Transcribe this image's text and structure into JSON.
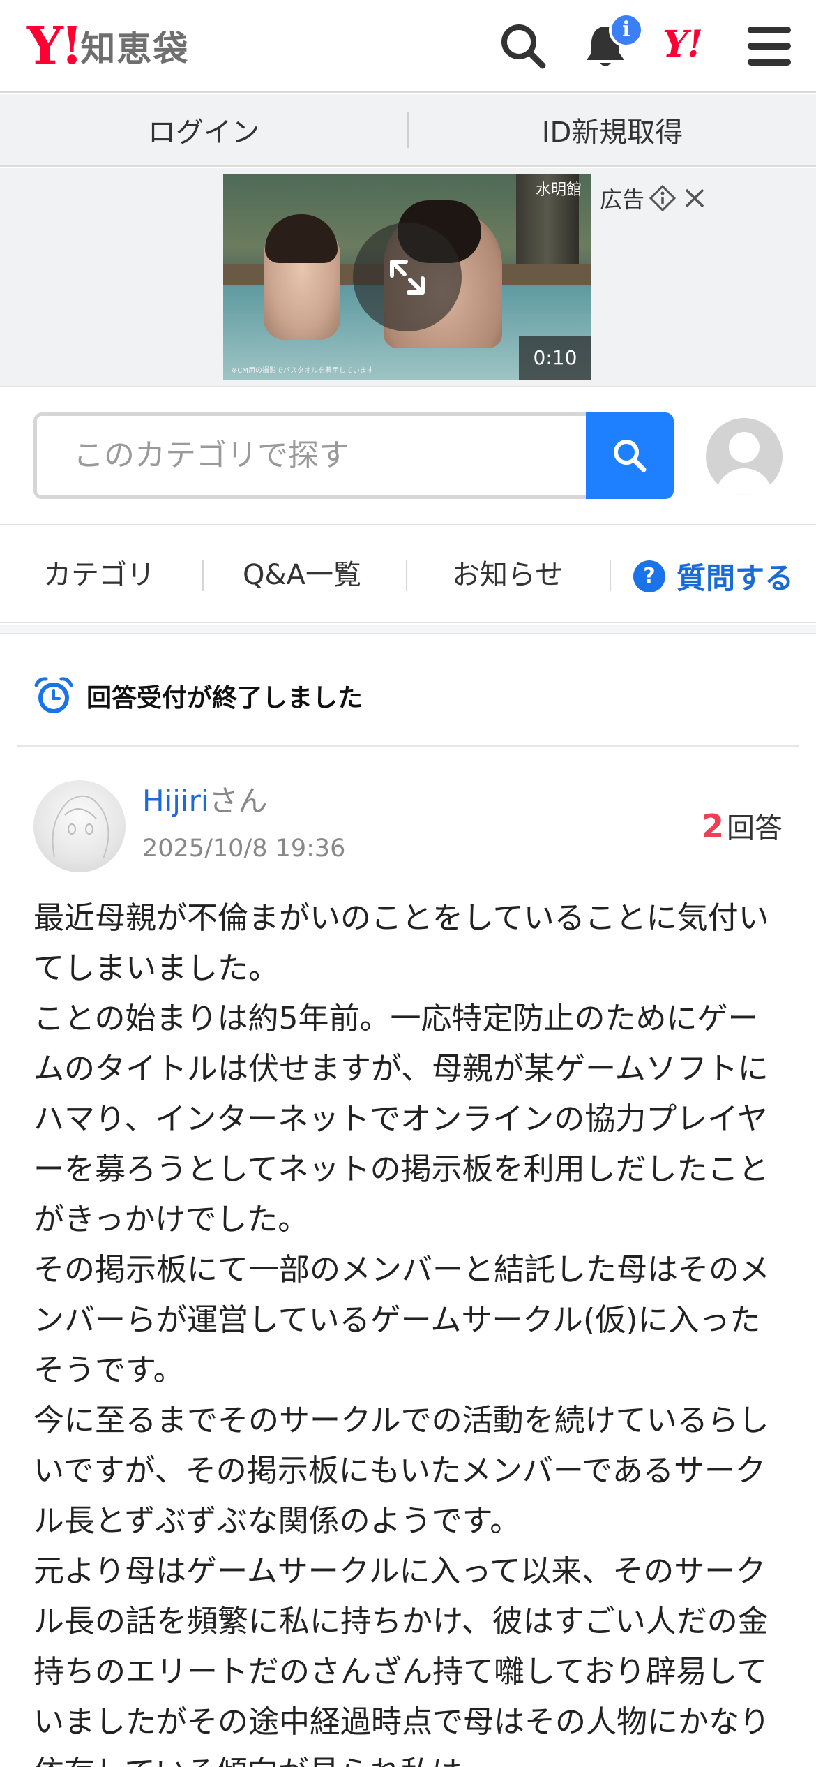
{
  "header": {
    "logo_mark": "Y!",
    "logo_text": "知恵袋",
    "notification_badge": "i",
    "yahoo_mini": "Y!",
    "icons": [
      "search-icon",
      "bell-icon",
      "yahoo-logo-icon",
      "menu-icon"
    ]
  },
  "loginbar": {
    "login": "ログイン",
    "register": "ID新規取得"
  },
  "ad": {
    "label": "広告",
    "brand": "水明館",
    "caption": "※CM用の撮影でバスタオルを着用しています",
    "duration": "0:10"
  },
  "search": {
    "placeholder": "このカテゴリで探す"
  },
  "nav": {
    "category": "カテゴリ",
    "qa_list": "Q&A一覧",
    "news": "お知らせ",
    "ask": "質問する"
  },
  "question": {
    "status": "回答受付が終了しました",
    "user_name": "Hijiri",
    "user_suffix": "さん",
    "date": "2025/10/8 19:36",
    "answer_count": "2",
    "answer_label": "回答",
    "body": "最近母親が不倫まがいのことをしていることに気付いてしまいました。\nことの始まりは約5年前。一応特定防止のためにゲームのタイトルは伏せますが、母親が某ゲームソフトにハマり、インターネットでオンラインの協力プレイヤーを募ろうとしてネットの掲示板を利用しだしたことがきっかけでした。\nその掲示板にて一部のメンバーと結託した母はそのメンバーらが運営しているゲームサークル(仮)に入ったそうです。\n今に至るまでそのサークルでの活動を続けているらしいですが、その掲示板にもいたメンバーであるサークル長とずぶずぶな関係のようです。\n元より母はゲームサークルに入って以来、そのサークル長の話を頻繁に私に持ちかけ、彼はすごい人だの金持ちのエリートだのさんざん持て囃しており辟易していましたがその途中経過時点で母はその人物にかなり依存している傾向が見られ私は"
  }
}
